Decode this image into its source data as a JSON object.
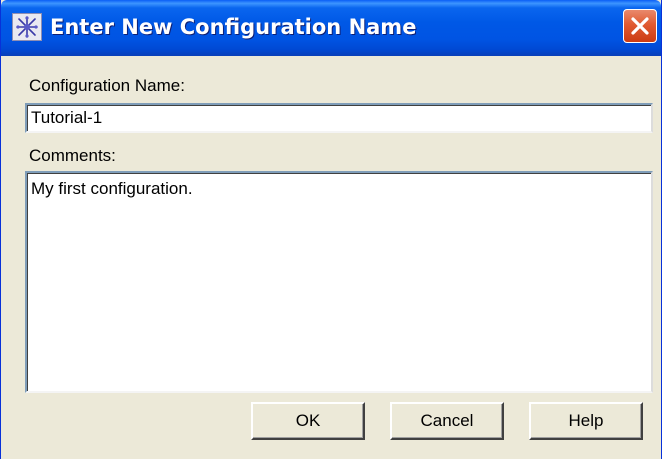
{
  "window": {
    "title": "Enter New Configuration Name",
    "icon": "app-logo-icon",
    "close_icon": "close-icon"
  },
  "form": {
    "config_name_label": "Configuration Name:",
    "config_name_value": "Tutorial-1",
    "comments_label": "Comments:",
    "comments_value": "My first configuration."
  },
  "buttons": {
    "ok": "OK",
    "cancel": "Cancel",
    "help": "Help"
  },
  "colors": {
    "titlebar": "#0054e3",
    "close_button": "#e05a31",
    "dialog_face": "#ece9d8"
  }
}
